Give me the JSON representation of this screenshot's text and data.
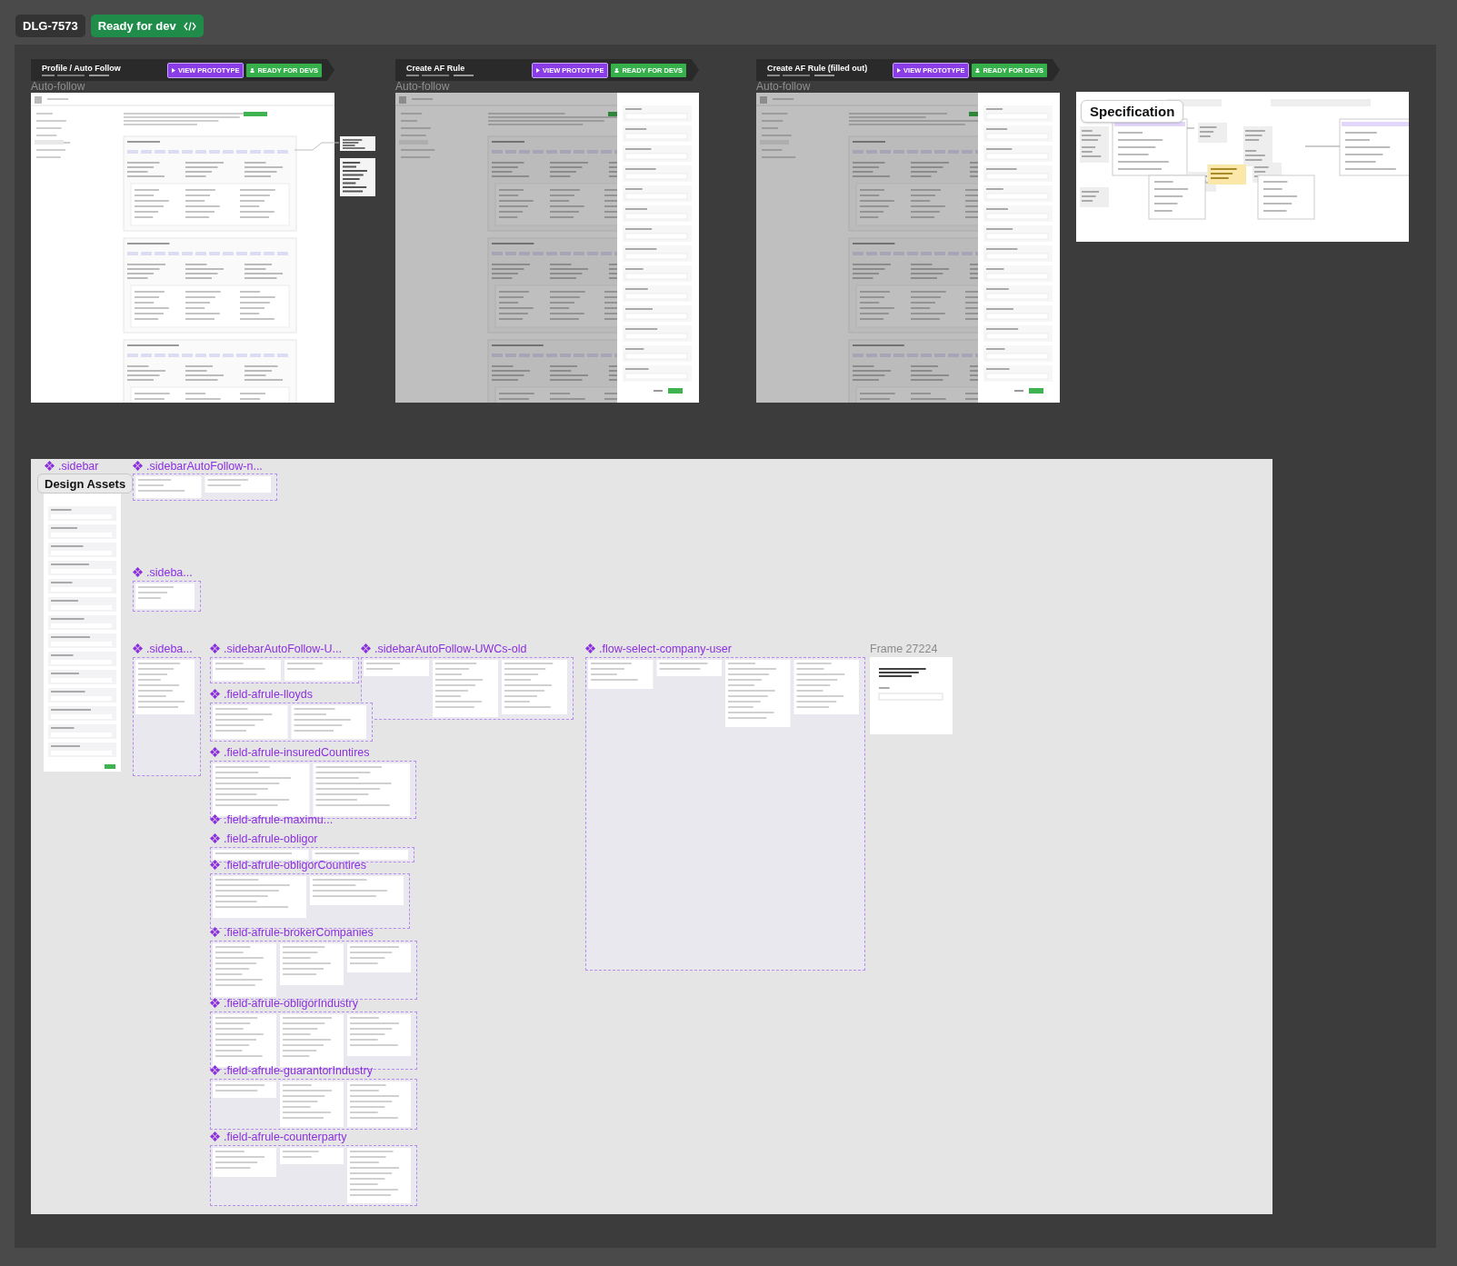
{
  "header": {
    "ticket": "DLG-7573",
    "status": "Ready for dev"
  },
  "frames": [
    {
      "title": "Profile / Auto Follow",
      "label": "Auto-follow",
      "kind": "page",
      "side_notes": true,
      "buttons": [
        {
          "label": "VIEW PROTOTYPE",
          "kind": "prototype"
        },
        {
          "label": "READY FOR DEVS",
          "kind": "ready"
        }
      ]
    },
    {
      "title": "Create AF Rule",
      "label": "Auto-follow",
      "kind": "drawer",
      "side_notes": false,
      "buttons": [
        {
          "label": "VIEW PROTOTYPE",
          "kind": "prototype"
        },
        {
          "label": "READY FOR DEVS",
          "kind": "ready"
        }
      ]
    },
    {
      "title": "Create AF Rule (filled out)",
      "label": "Auto-follow",
      "kind": "drawer",
      "side_notes": false,
      "buttons": [
        {
          "label": "VIEW PROTOTYPE",
          "kind": "prototype"
        },
        {
          "label": "READY FOR DEVS",
          "kind": "ready"
        }
      ]
    }
  ],
  "specification": {
    "title": "Specification"
  },
  "design_assets": {
    "title": "Design Assets",
    "items": [
      {
        "name": ".sidebar",
        "kind": "component"
      },
      {
        "name": ".sidebarAutoFollow-n...",
        "kind": "component"
      },
      {
        "name": ".sideba...",
        "kind": "component"
      },
      {
        "name": ".sideba...",
        "kind": "component"
      },
      {
        "name": ".sidebarAutoFollow-U...",
        "kind": "component"
      },
      {
        "name": ".sidebarAutoFollow-UWCs-old",
        "kind": "component"
      },
      {
        "name": ".flow-select-company-user",
        "kind": "component"
      },
      {
        "name": "Frame 27224",
        "kind": "frame"
      },
      {
        "name": ".field-afrule-lloyds",
        "kind": "component"
      },
      {
        "name": ".field-afrule-insuredCountires",
        "kind": "component"
      },
      {
        "name": ".field-afrule-maximu...",
        "kind": "component"
      },
      {
        "name": ".field-afrule-obligor",
        "kind": "component"
      },
      {
        "name": ".field-afrule-obligorCountires",
        "kind": "component"
      },
      {
        "name": ".field-afrule-brokerCompanies",
        "kind": "component"
      },
      {
        "name": ".field-afrule-obligorIndustry",
        "kind": "component"
      },
      {
        "name": ".field-afrule-guarantorIndustry",
        "kind": "component"
      },
      {
        "name": ".field-afrule-counterparty",
        "kind": "component"
      }
    ]
  }
}
